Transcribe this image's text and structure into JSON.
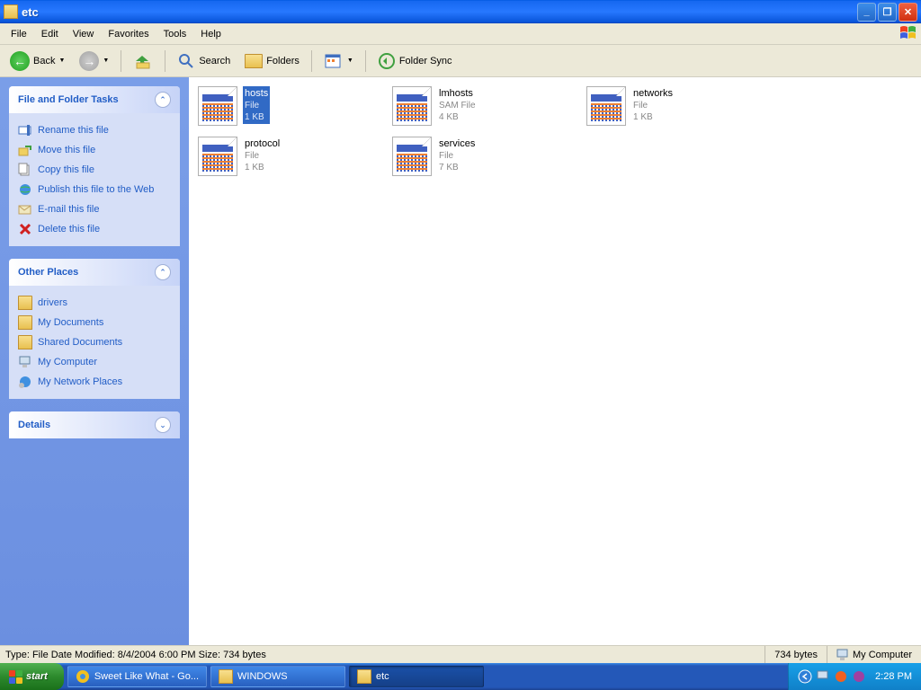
{
  "window": {
    "title": "etc"
  },
  "menu": {
    "items": [
      "File",
      "Edit",
      "View",
      "Favorites",
      "Tools",
      "Help"
    ]
  },
  "toolbar": {
    "back": "Back",
    "search": "Search",
    "folders": "Folders",
    "foldersync": "Folder Sync"
  },
  "panels": {
    "tasks": {
      "title": "File and Folder Tasks",
      "items": [
        "Rename this file",
        "Move this file",
        "Copy this file",
        "Publish this file to the Web",
        "E-mail this file",
        "Delete this file"
      ]
    },
    "places": {
      "title": "Other Places",
      "items": [
        "drivers",
        "My Documents",
        "Shared Documents",
        "My Computer",
        "My Network Places"
      ]
    },
    "details": {
      "title": "Details"
    }
  },
  "files": [
    {
      "name": "hosts",
      "type": "File",
      "size": "1 KB",
      "selected": true
    },
    {
      "name": "lmhosts",
      "type": "SAM File",
      "size": "4 KB",
      "selected": false
    },
    {
      "name": "networks",
      "type": "File",
      "size": "1 KB",
      "selected": false
    },
    {
      "name": "protocol",
      "type": "File",
      "size": "1 KB",
      "selected": false
    },
    {
      "name": "services",
      "type": "File",
      "size": "7 KB",
      "selected": false
    }
  ],
  "statusbar": {
    "left": "Type: File Date Modified: 8/4/2004 6:00 PM Size: 734 bytes",
    "size": "734 bytes",
    "location": "My Computer"
  },
  "taskbar": {
    "start": "start",
    "items": [
      {
        "label": "Sweet Like What - Go...",
        "active": false
      },
      {
        "label": "WINDOWS",
        "active": false
      },
      {
        "label": "etc",
        "active": true
      }
    ],
    "clock": "2:28 PM"
  }
}
